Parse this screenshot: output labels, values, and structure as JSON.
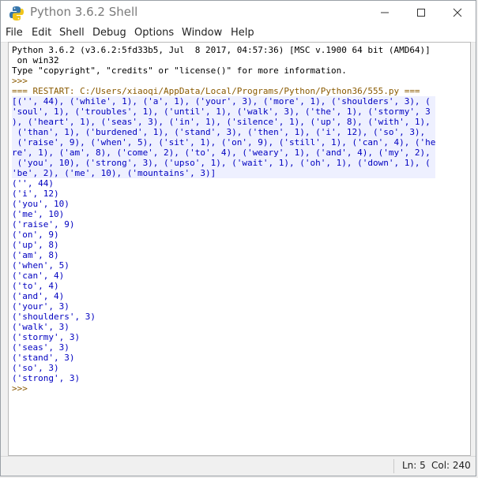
{
  "window": {
    "title": "Python 3.6.2 Shell",
    "controls": {
      "minimize": "minimize",
      "maximize": "maximize",
      "close": "close"
    }
  },
  "menu": [
    "File",
    "Edit",
    "Shell",
    "Debug",
    "Options",
    "Window",
    "Help"
  ],
  "shell": {
    "lines": [
      {
        "text": "Python 3.6.2 (v3.6.2:5fd33b5, Jul  8 2017, 04:57:36) [MSC v.1900 64 bit (AMD64)]",
        "kind": "normal"
      },
      {
        "text": " on win32",
        "kind": "normal"
      },
      {
        "text": "Type \"copyright\", \"credits\" or \"license()\" for more information.",
        "kind": "normal"
      },
      {
        "text": ">>> ",
        "kind": "prompt"
      },
      {
        "text": "=== RESTART: C:/Users/xiaoqi/AppData/Local/Programs/Python/Python36/555.py ===",
        "kind": "restart"
      },
      {
        "text": "[('', 44), ('while', 1), ('a', 1), ('your', 3), ('more', 1), ('shoulders', 3), (",
        "kind": "out hl"
      },
      {
        "text": "'soul', 1), ('troubles', 1), ('until', 1), ('walk', 3), ('the', 1), ('stormy', 3",
        "kind": "out hl"
      },
      {
        "text": "), ('heart', 1), ('seas', 3), ('in', 1), ('silence', 1), ('up', 8), ('with', 1),",
        "kind": "out hl"
      },
      {
        "text": " ('than', 1), ('burdened', 1), ('stand', 3), ('then', 1), ('i', 12), ('so', 3),",
        "kind": "out hl"
      },
      {
        "text": " ('raise', 9), ('when', 5), ('sit', 1), ('on', 9), ('still', 1), ('can', 4), ('he",
        "kind": "out hl"
      },
      {
        "text": "re', 1), ('am', 8), ('come', 2), ('to', 4), ('weary', 1), ('and', 4), ('my', 2),",
        "kind": "out hl"
      },
      {
        "text": " ('you', 10), ('strong', 3), ('upso', 1), ('wait', 1), ('oh', 1), ('down', 1), (",
        "kind": "out hl"
      },
      {
        "text": "'be', 2), ('me', 10), ('mountains', 3)]",
        "kind": "out hl"
      },
      {
        "text": "('', 44)",
        "kind": "out"
      },
      {
        "text": "('i', 12)",
        "kind": "out"
      },
      {
        "text": "('you', 10)",
        "kind": "out"
      },
      {
        "text": "('me', 10)",
        "kind": "out"
      },
      {
        "text": "('raise', 9)",
        "kind": "out"
      },
      {
        "text": "('on', 9)",
        "kind": "out"
      },
      {
        "text": "('up', 8)",
        "kind": "out"
      },
      {
        "text": "('am', 8)",
        "kind": "out"
      },
      {
        "text": "('when', 5)",
        "kind": "out"
      },
      {
        "text": "('can', 4)",
        "kind": "out"
      },
      {
        "text": "('to', 4)",
        "kind": "out"
      },
      {
        "text": "('and', 4)",
        "kind": "out"
      },
      {
        "text": "('your', 3)",
        "kind": "out"
      },
      {
        "text": "('shoulders', 3)",
        "kind": "out"
      },
      {
        "text": "('walk', 3)",
        "kind": "out"
      },
      {
        "text": "('stormy', 3)",
        "kind": "out"
      },
      {
        "text": "('seas', 3)",
        "kind": "out"
      },
      {
        "text": "('stand', 3)",
        "kind": "out"
      },
      {
        "text": "('so', 3)",
        "kind": "out"
      },
      {
        "text": "('strong', 3)",
        "kind": "out"
      },
      {
        "text": ">>> ",
        "kind": "prompt"
      }
    ]
  },
  "status": {
    "ln": "Ln: 5",
    "col": "Col: 240"
  },
  "colors": {
    "output": "#0000c0",
    "prompt": "#8a5a00",
    "highlight": "#eef0ff"
  }
}
